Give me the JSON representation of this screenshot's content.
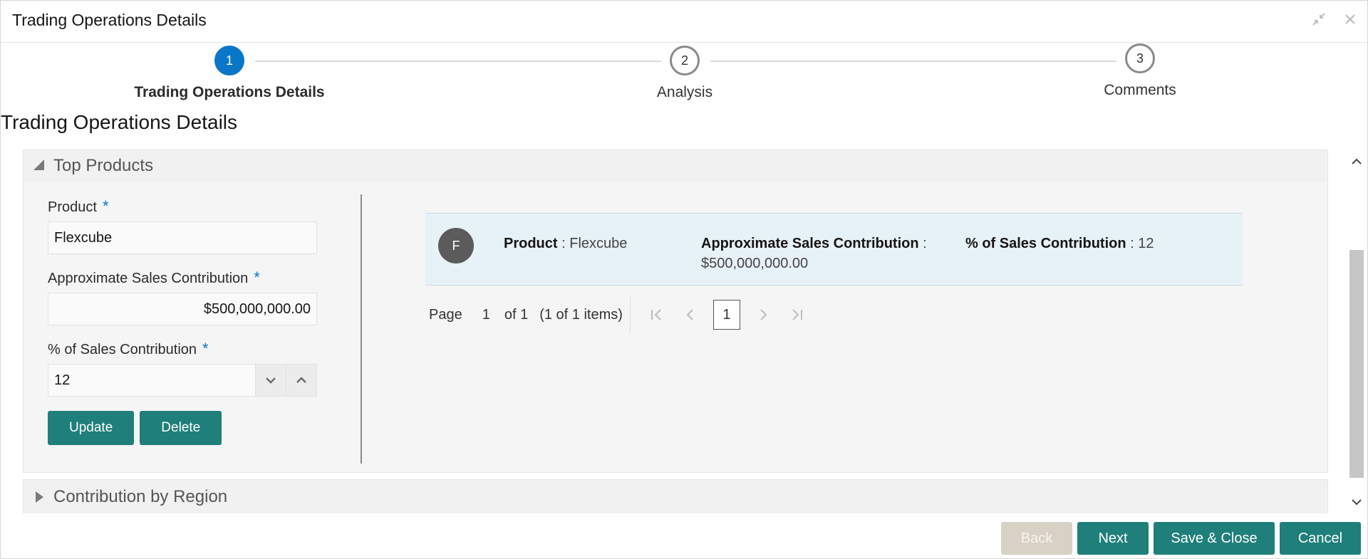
{
  "window": {
    "title": "Trading Operations Details"
  },
  "stepper": {
    "steps": [
      {
        "number": "1",
        "label": "Trading Operations Details"
      },
      {
        "number": "2",
        "label": "Analysis"
      },
      {
        "number": "3",
        "label": "Comments"
      }
    ],
    "active_index": 0
  },
  "section_title": "Trading Operations Details",
  "top_products": {
    "header": "Top Products",
    "expanded": true,
    "form": {
      "product_label": "Product",
      "product_value": "Flexcube",
      "sales_label": "Approximate Sales Contribution",
      "sales_value": "$500,000,000.00",
      "pct_label": "% of Sales Contribution",
      "pct_value": "12",
      "required_mark": "*",
      "update_label": "Update",
      "delete_label": "Delete"
    },
    "card": {
      "avatar": "F",
      "product_key": "Product",
      "product_value": "Flexcube",
      "sales_key": "Approximate Sales Contribution",
      "sales_value": "$500,000,000.00",
      "pct_key": "% of Sales Contribution",
      "pct_value": "12",
      "separator": ":"
    },
    "pager": {
      "page_label": "Page",
      "page_input": "1",
      "of_label": "of 1",
      "items_label": "(1 of 1 items)",
      "current_page": "1"
    }
  },
  "contribution_by_region": {
    "header": "Contribution by Region",
    "expanded": false
  },
  "footer": {
    "back_label": "Back",
    "next_label": "Next",
    "save_close_label": "Save & Close",
    "cancel_label": "Cancel"
  },
  "colors": {
    "accent": "#1f7f7a",
    "step_active": "#0a76c8",
    "required": "#0a76c8"
  },
  "icons": [
    "collapse-icon",
    "close-icon",
    "triangle-down-icon",
    "triangle-right-icon",
    "chevron-down-icon",
    "chevron-up-icon",
    "first-page-icon",
    "prev-page-icon",
    "next-page-icon",
    "last-page-icon"
  ]
}
